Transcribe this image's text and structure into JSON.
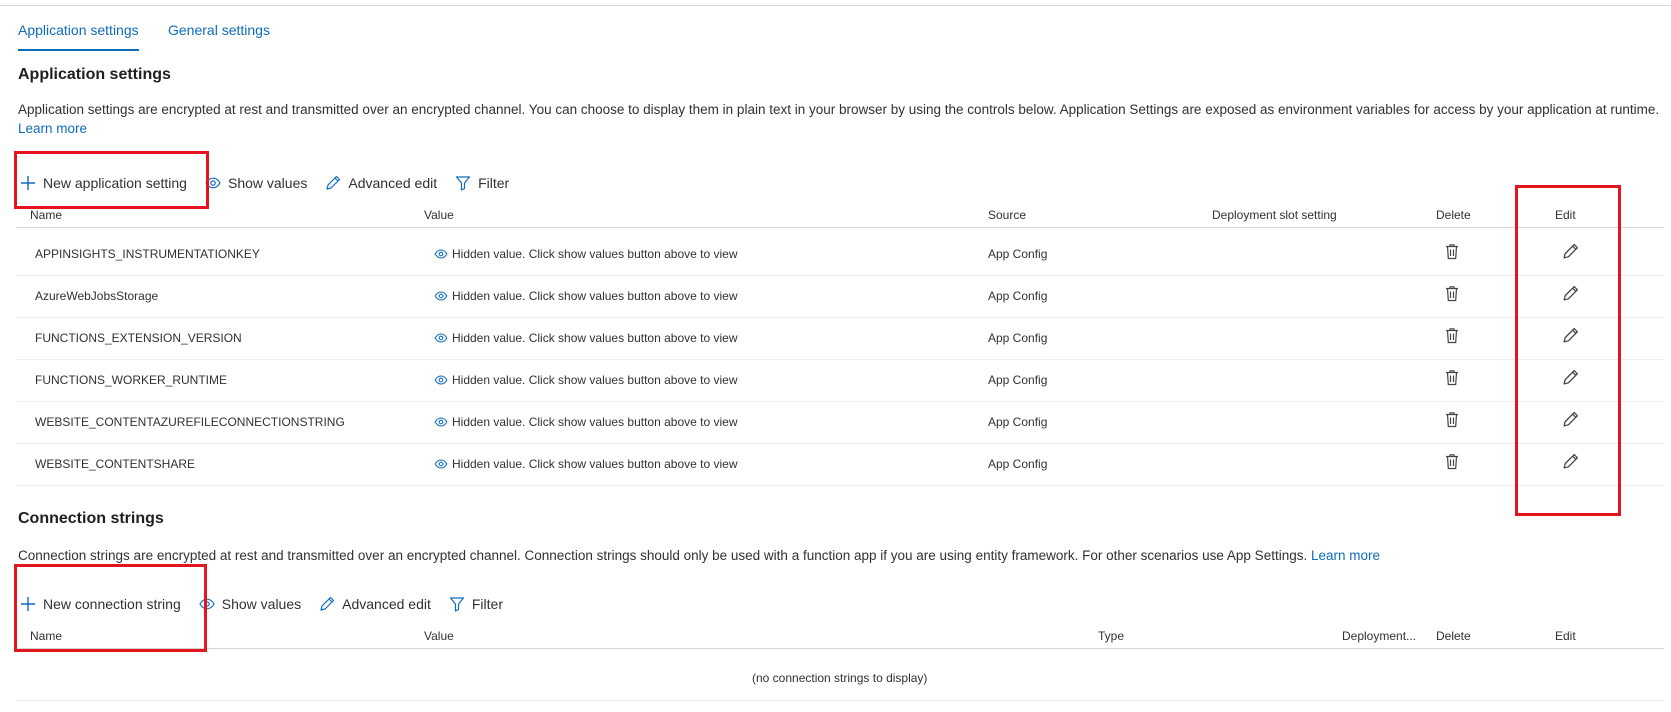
{
  "tabs": {
    "app_settings": "Application settings",
    "general_settings": "General settings"
  },
  "app_settings": {
    "title": "Application settings",
    "description": "Application settings are encrypted at rest and transmitted over an encrypted channel. You can choose to display them in plain text in your browser by using the controls below. Application Settings are exposed as environment variables for access by your application at runtime.",
    "learn_more": "Learn more",
    "toolbar": {
      "new": "New application setting",
      "show_values": "Show values",
      "advanced_edit": "Advanced edit",
      "filter": "Filter"
    },
    "columns": {
      "name": "Name",
      "value": "Value",
      "source": "Source",
      "slot": "Deployment slot setting",
      "delete": "Delete",
      "edit": "Edit"
    },
    "rows": [
      {
        "name": "APPINSIGHTS_INSTRUMENTATIONKEY",
        "value": "Hidden value. Click show values button above to view",
        "source": "App Config"
      },
      {
        "name": "AzureWebJobsStorage",
        "value": "Hidden value. Click show values button above to view",
        "source": "App Config"
      },
      {
        "name": "FUNCTIONS_EXTENSION_VERSION",
        "value": "Hidden value. Click show values button above to view",
        "source": "App Config"
      },
      {
        "name": "FUNCTIONS_WORKER_RUNTIME",
        "value": "Hidden value. Click show values button above to view",
        "source": "App Config"
      },
      {
        "name": "WEBSITE_CONTENTAZUREFILECONNECTIONSTRING",
        "value": "Hidden value. Click show values button above to view",
        "source": "App Config"
      },
      {
        "name": "WEBSITE_CONTENTSHARE",
        "value": "Hidden value. Click show values button above to view",
        "source": "App Config"
      }
    ]
  },
  "conn_strings": {
    "title": "Connection strings",
    "description": "Connection strings are encrypted at rest and transmitted over an encrypted channel. Connection strings should only be used with a function app if you are using entity framework. For other scenarios use App Settings.",
    "learn_more": "Learn more",
    "toolbar": {
      "new": "New connection string",
      "show_values": "Show values",
      "advanced_edit": "Advanced edit",
      "filter": "Filter"
    },
    "columns": {
      "name": "Name",
      "value": "Value",
      "type": "Type",
      "slot": "Deployment...",
      "delete": "Delete",
      "edit": "Edit"
    },
    "empty": "(no connection strings to display)"
  },
  "colors": {
    "accent": "#0f6cbd",
    "highlight": "#e3151f"
  },
  "icons": [
    "plus-icon",
    "eye-icon",
    "pencil-icon",
    "filter-icon",
    "trash-icon"
  ]
}
